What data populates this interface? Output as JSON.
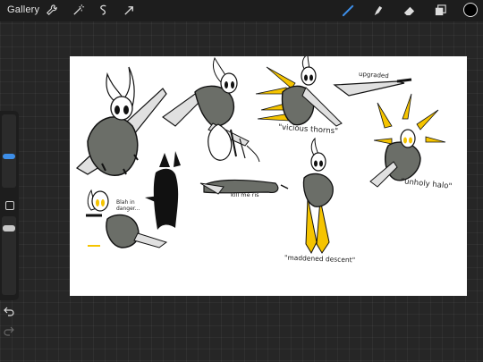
{
  "app": {
    "gallery_label": "Gallery"
  },
  "toolbar": {
    "left_icons": [
      "wrench-icon",
      "magic-wand-icon",
      "selection-icon",
      "transform-arrow-icon"
    ],
    "right_icons": [
      "brush-icon",
      "smudge-icon",
      "eraser-icon",
      "layers-icon"
    ],
    "active_tool": "brush",
    "accent_color": "#3d8ee8",
    "current_color": "#000000"
  },
  "sidebar": {
    "brush_size_slider": "brush-size",
    "opacity_slider": "opacity",
    "undo_icon": "undo-arrow-icon",
    "redo_icon": "redo-arrow-icon"
  },
  "canvas": {
    "annotations": {
      "vicious_thorns": "\"vicious thorns\"",
      "upgraded": "upgraded",
      "unholy_halo": "\"unholy halo\"",
      "kill_me_ris": "kill me ris",
      "blah_in_danger": "Blah in danger...",
      "maddened_descent": "\"maddened descent\""
    },
    "palette": {
      "cloak": "#6b6e68",
      "outline": "#111111",
      "mask": "#ffffff",
      "gold": "#f5c400",
      "blade": "#d9d9d9"
    }
  }
}
